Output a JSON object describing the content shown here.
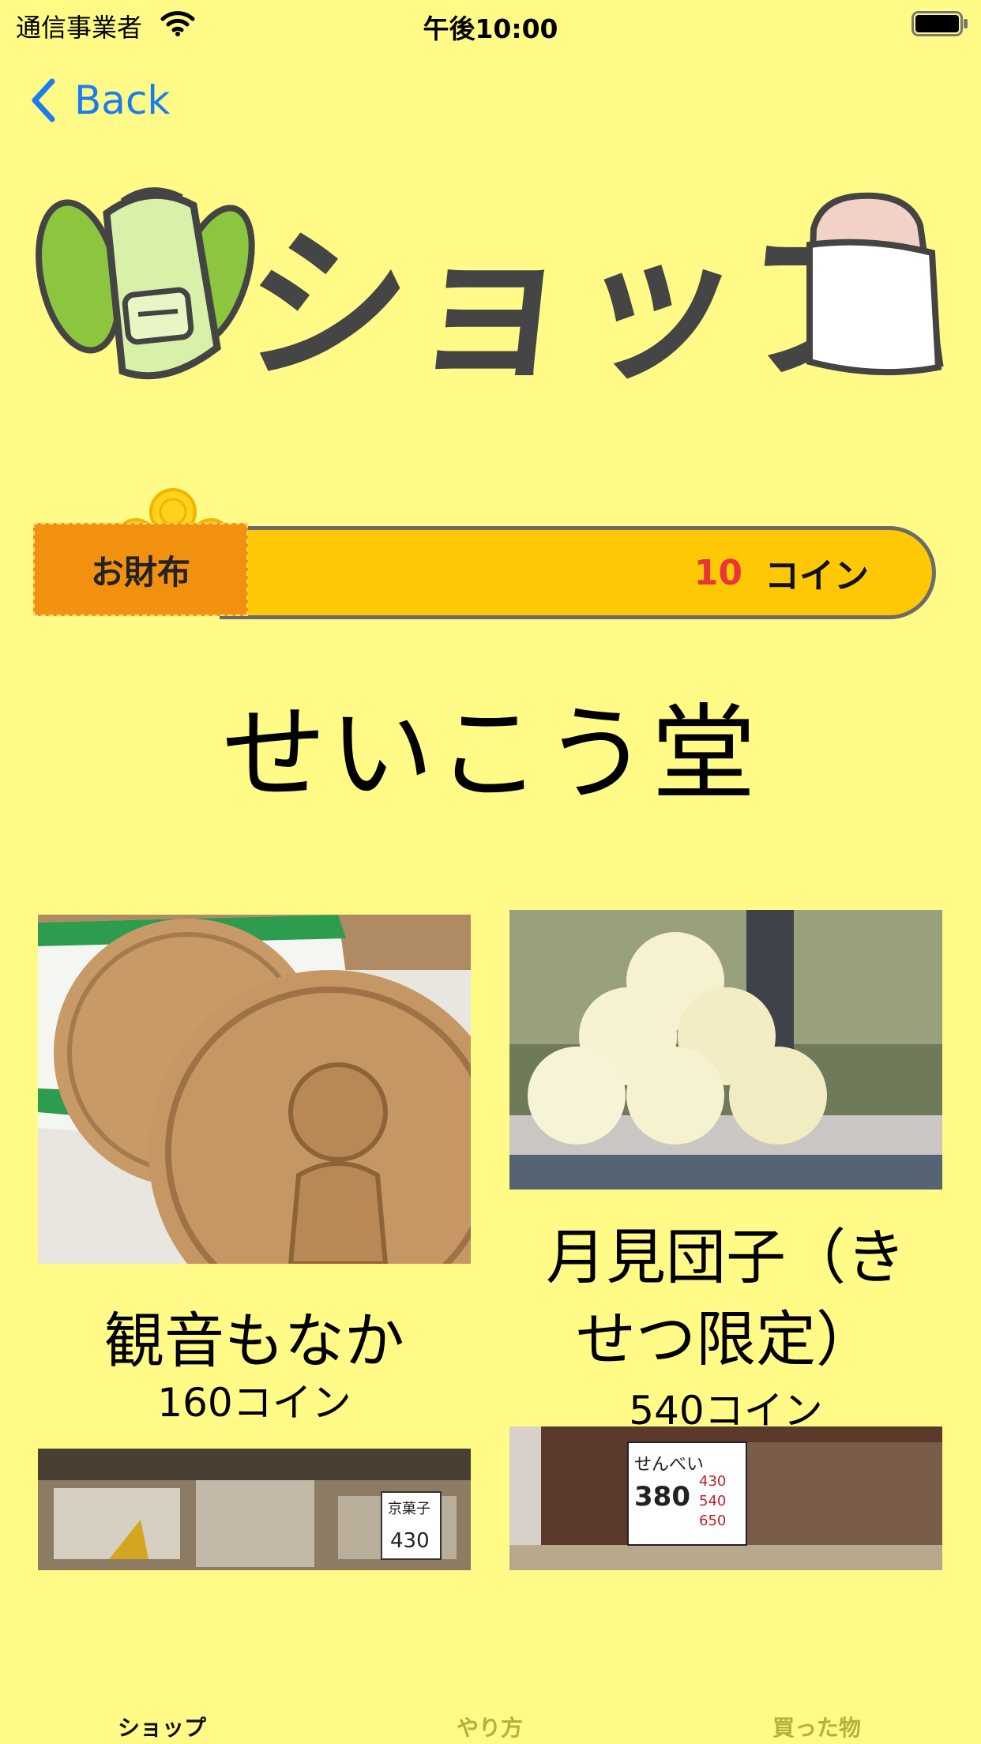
{
  "status_bar": {
    "carrier": "通信事業者",
    "time": "午後10:00"
  },
  "nav": {
    "back_label": "Back"
  },
  "header": {
    "title_art_text": "ショップ"
  },
  "wallet": {
    "label": "お財布",
    "coins": "10",
    "unit": "コイン"
  },
  "shop": {
    "name": "せいこう堂"
  },
  "products": [
    {
      "name": "観音もなか",
      "price": "160コイン"
    },
    {
      "name": "月見団子（きせつ限定）",
      "name_line1": "月見団子（き",
      "name_line2": "せつ限定）",
      "price": "540コイン"
    },
    {
      "photo_text": "京菓子 430円"
    },
    {
      "photo_text": "せんべい あられ 380 430 540 650"
    }
  ],
  "tabs": [
    {
      "label": "ショップ",
      "active": true
    },
    {
      "label": "やり方",
      "active": false
    },
    {
      "label": "買った物",
      "active": false
    }
  ],
  "colors": {
    "background": "#FFFB86",
    "accent": "#1A7CF2",
    "wallet_bar": "#FFC805",
    "wallet_tag": "#F2910F",
    "coin_count": "#E8343A"
  }
}
